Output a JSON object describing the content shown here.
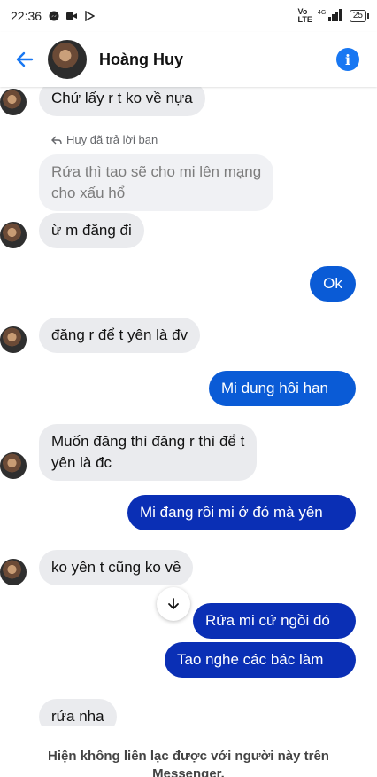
{
  "status_bar": {
    "time": "22:36",
    "network": "4G",
    "battery": "25"
  },
  "header": {
    "title": "Hoàng Huy",
    "back_icon": "arrow-left-icon",
    "info_icon": "info-icon"
  },
  "messages": {
    "m1": "Chứ lấy r t ko về nựa",
    "reply_note": "Huy đã trả lời bạn",
    "quoted_line1": "Rứa thì tao sẽ cho mi lên mạng",
    "quoted_line2": "cho xấu hổ",
    "m2": "ừ m đăng đi",
    "m3": "Ok",
    "m4": "đăng r để t yên là đv",
    "m5": "Mi dung hôi han",
    "m6_line1": "Muốn đăng thì đăng r thì để t",
    "m6_line2": "yên là đc",
    "m7": "Mi đang rồi mi ở đó mà yên",
    "m8": "ko yên t cũng ko về",
    "m9": "Rứa mi cứ ngồi đó",
    "m10": "Tao nghe các bác làm",
    "m11": "rứa nha"
  },
  "footer": {
    "line1": "Hiện không liên lạc được với người này trên",
    "line2": "Messenger."
  },
  "colors": {
    "accent": "#1877f2",
    "outgoing": "#0a5bd6",
    "outgoing_dark": "#0a2fb5",
    "incoming": "#eaebee"
  }
}
